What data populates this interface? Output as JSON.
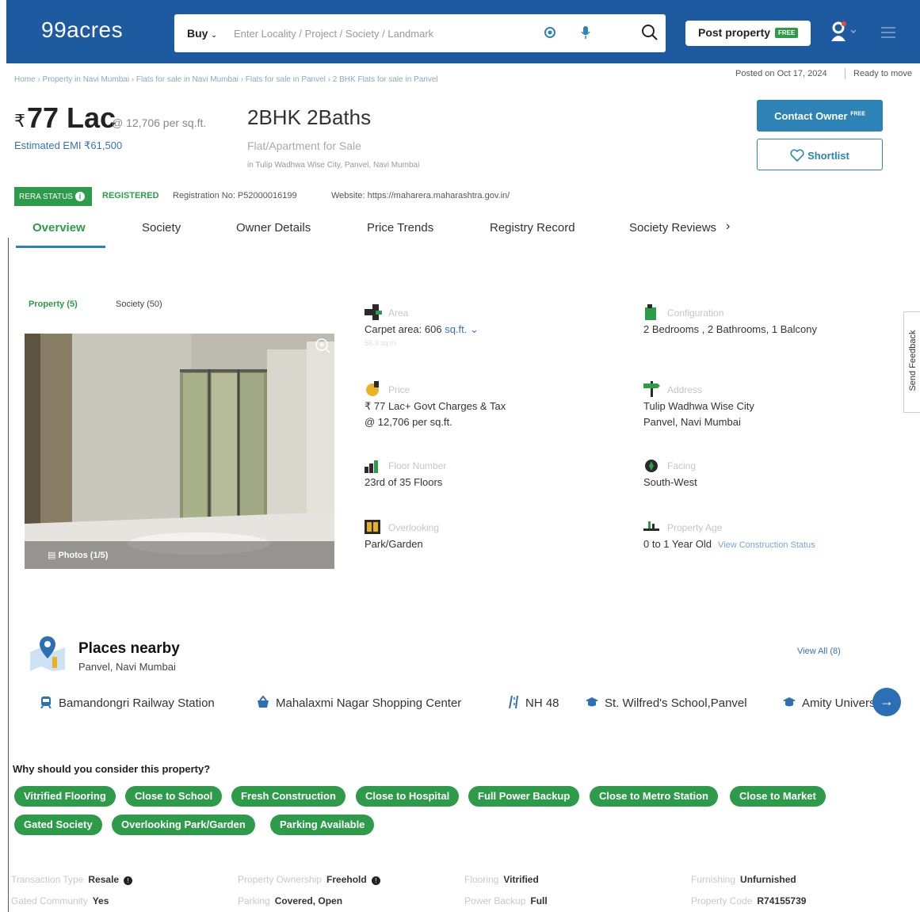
{
  "header": {
    "logo": "99acres",
    "buy_label": "Buy",
    "search_placeholder": "Enter Locality / Project / Society / Landmark",
    "post_property": "Post property",
    "free_tag": "FREE"
  },
  "breadcrumb": "Home › Property in Navi Mumbai › Flats for sale in Navi Mumbai › Flats for sale in Panvel › 2 BHK Flats for sale in Panvel",
  "meta": {
    "posted": "Posted on Oct 17, 2024",
    "ready": "Ready to move"
  },
  "listing": {
    "rupee": "₹",
    "price": "77 Lac",
    "price_per_sqft": "@ 12,706 per sq.ft.",
    "emi": "Estimated EMI ₹61,500",
    "title": "2BHK 2Baths",
    "subtitle": "Flat/Apartment for Sale",
    "location": "in Tulip Wadhwa Wise City, Panvel, Navi Mumbai"
  },
  "actions": {
    "contact": "Contact Owner",
    "contact_tag": "FREE",
    "shortlist": "Shortlist"
  },
  "rera": {
    "badge": "RERA STATUS",
    "status": "REGISTERED",
    "registration": "Registration No: P52000016199",
    "website": "Website: https://maharera.maharashtra.gov.in/"
  },
  "tabs": [
    "Overview",
    "Society",
    "Owner Details",
    "Price Trends",
    "Registry Record",
    "Society Reviews"
  ],
  "gallery": {
    "tab_property": "Property (5)",
    "tab_society": "Society (50)",
    "photos_label": "Photos (1/5)"
  },
  "details": {
    "area_label": "Area",
    "area_value": "Carpet area: 606",
    "area_unit": "sq.ft.",
    "area_sub": "56.3 sq.m.",
    "config_label": "Configuration",
    "config_value": "2 Bedrooms , 2 Bathrooms, 1 Balcony",
    "price_label": "Price",
    "price_value": "₹ 77 Lac+ Govt Charges & Tax",
    "price_value2": "@ 12,706 per sq.ft.",
    "address_label": "Address",
    "address_value": "Tulip Wadhwa Wise City",
    "address_value2": "Panvel, Navi Mumbai",
    "floor_label": "Floor Number",
    "floor_value": "23rd  of 35 Floors",
    "facing_label": "Facing",
    "facing_value": "South-West",
    "overlooking_label": "Overlooking",
    "overlooking_value": "Park/Garden",
    "age_label": "Property Age",
    "age_value": "0 to 1 Year Old",
    "age_link": "View Construction Status"
  },
  "feedback": "Send Feedback",
  "places": {
    "title": "Places nearby",
    "subtitle": "Panvel, Navi Mumbai",
    "view_all": "View All (8)",
    "items": [
      "Bamandongri Railway Station",
      "Mahalaxmi Nagar Shopping Center",
      "NH 48",
      "St. Wilfred's School,Panvel",
      "Amity University"
    ]
  },
  "why": {
    "title": "Why should you consider this property?",
    "chips": [
      "Vitrified Flooring",
      "Close to School",
      "Fresh Construction",
      "Close to Hospital",
      "Full Power Backup",
      "Close to Metro Station",
      "Close to Market",
      "Gated Society",
      "Overlooking Park/Garden",
      "Parking Available"
    ]
  },
  "facts": [
    {
      "k": "Transaction Type",
      "v": "Resale"
    },
    {
      "k": "Property Ownership",
      "v": "Freehold"
    },
    {
      "k": "Flooring",
      "v": "Vitrified"
    },
    {
      "k": "Furnishing",
      "v": "Unfurnished"
    },
    {
      "k": "Gated Community",
      "v": "Yes"
    },
    {
      "k": "Parking",
      "v": "Covered, Open"
    },
    {
      "k": "Power Backup",
      "v": "Full"
    },
    {
      "k": "Property Code",
      "v": "R74155739"
    }
  ],
  "colors": {
    "brand_blue": "#1e5aa0",
    "accent_green": "#2e9b4a",
    "button_blue": "#2d83b6"
  }
}
